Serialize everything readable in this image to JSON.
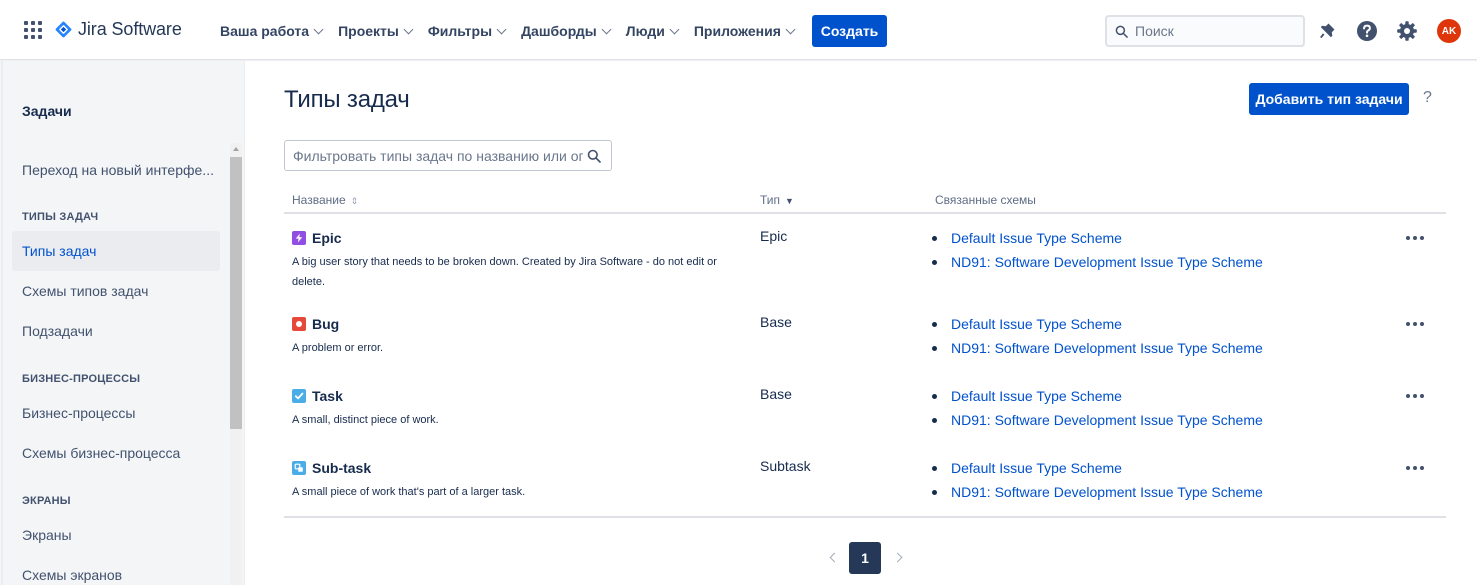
{
  "brand": {
    "product_name": "Jira Software",
    "accent": "#0052cc"
  },
  "topnav": {
    "items": [
      {
        "label": "Ваша работа"
      },
      {
        "label": "Проекты"
      },
      {
        "label": "Фильтры"
      },
      {
        "label": "Дашборды"
      },
      {
        "label": "Люди"
      },
      {
        "label": "Приложения"
      }
    ],
    "create_label": "Создать",
    "search_placeholder": "Поиск",
    "icons": [
      "notifications-icon",
      "help-icon",
      "settings-icon"
    ],
    "avatar_initials": "AK"
  },
  "sidebar": {
    "title": "Задачи",
    "top_item": "Переход на новый интерфе...",
    "sections": [
      {
        "heading": "ТИПЫ ЗАДАЧ",
        "items": [
          "Типы задач",
          "Схемы типов задач",
          "Подзадачи"
        ]
      },
      {
        "heading": "БИЗНЕС-ПРОЦЕССЫ",
        "items": [
          "Бизнес-процессы",
          "Схемы бизнес-процесса"
        ]
      },
      {
        "heading": "ЭКРАНЫ",
        "items": [
          "Экраны",
          "Схемы экранов"
        ]
      }
    ],
    "active_item": "Типы задач"
  },
  "main": {
    "title": "Типы задач",
    "add_button_label": "Добавить тип задачи",
    "help_label": "?",
    "filter_placeholder": "Фильтровать типы задач по названию или оп",
    "columns": {
      "name": "Название",
      "type": "Тип",
      "schemes": "Связанные схемы"
    },
    "rows": [
      {
        "name": "Epic",
        "icon": "epic-icon",
        "icon_color": "#904ee2",
        "description": "A big user story that needs to be broken down. Created by Jira Software - do not edit or delete.",
        "type": "Epic",
        "schemes": [
          "Default Issue Type Scheme",
          "ND91: Software Development Issue Type Scheme"
        ]
      },
      {
        "name": "Bug",
        "icon": "bug-icon",
        "icon_color": "#e5493a",
        "description": "A problem or error.",
        "type": "Base",
        "schemes": [
          "Default Issue Type Scheme",
          "ND91: Software Development Issue Type Scheme"
        ]
      },
      {
        "name": "Task",
        "icon": "task-icon",
        "icon_color": "#4bade8",
        "description": "A small, distinct piece of work.",
        "type": "Base",
        "schemes": [
          "Default Issue Type Scheme",
          "ND91: Software Development Issue Type Scheme"
        ]
      },
      {
        "name": "Sub-task",
        "icon": "subtask-icon",
        "icon_color": "#4bade8",
        "description": "A small piece of work that's part of a larger task.",
        "type": "Subtask",
        "schemes": [
          "Default Issue Type Scheme",
          "ND91: Software Development Issue Type Scheme"
        ]
      }
    ],
    "pagination": {
      "current_page": "1"
    }
  }
}
